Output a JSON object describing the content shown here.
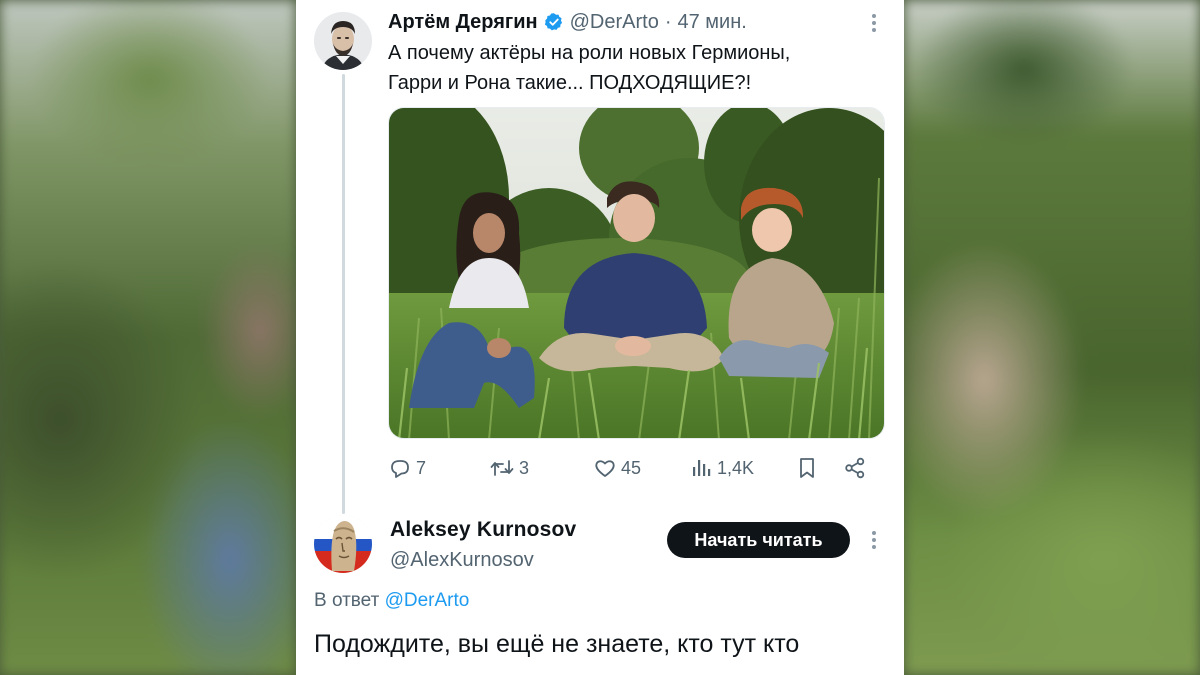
{
  "tweet": {
    "author_name": "Артём Дерягин",
    "author_handle": "@DerArto",
    "separator": "·",
    "time": "47 мин.",
    "text_line1": "А почему актёры на роли новых Гермионы,",
    "text_line2": "Гарри и Рона такие... ПОДХОДЯЩИЕ?!",
    "stats": {
      "replies": "7",
      "retweets": "3",
      "likes": "45",
      "views": "1,4K"
    },
    "icons": [
      "verified-badge-icon",
      "reply-icon",
      "retweet-icon",
      "like-icon",
      "views-icon",
      "bookmark-icon",
      "share-icon",
      "more-icon"
    ]
  },
  "reply": {
    "author_name": "Aleksey Kurnosov",
    "author_handle": "@AlexKurnosov",
    "follow_label": "Начать читать",
    "reply_prefix": "В ответ",
    "reply_to": "@DerArto",
    "text": "Подождите, вы ещё не знаете, кто тут кто"
  },
  "colors": {
    "text_primary": "#0f1419",
    "text_secondary": "#536471",
    "accent": "#1d9bf0",
    "button_bg": "#0f1419",
    "thread_line": "#cfd9de"
  }
}
